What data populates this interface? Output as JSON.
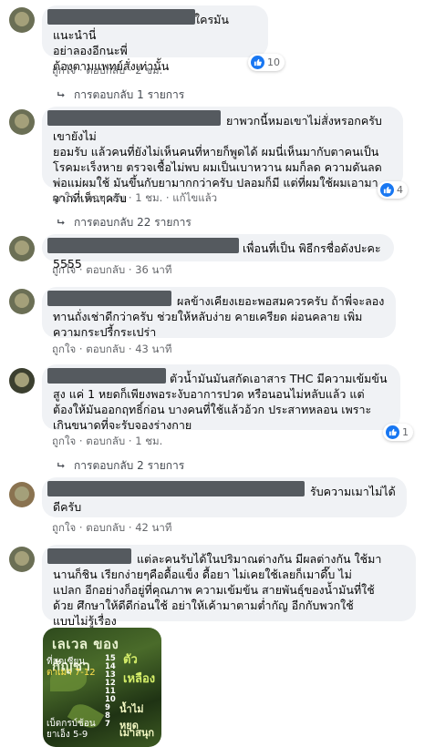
{
  "comments": [
    {
      "text": "ใครมันแนะนำนี่\nอย่าลองอีกนะพี่\nต้องตามแพทย์สั่งเท่านั้น",
      "like": "ถูกใจ",
      "reply": "ตอบกลับ",
      "time": "2 ชม.",
      "reaction_count": "10",
      "replies": "การตอบกลับ 1 รายการ"
    },
    {
      "text": "ยาพวกนี้หมอเขาไม่สั่งหรอกครับ เขายังไม่\nยอมรับ แล้วคนที่ยังไม่เห็นคนที่หายก็พูดได้ ผมนี่เห็นมากับตาคนเป็น\nโรคมะเร็งหาย ตรวจเชื้อไม่พบ ผมเป็นเบาหวาน ผมก็ลด ความดันลด\nพ่อแม่ผมใช้ มันขึ้นกับยามากกว่าครับ ปลอมก็มี แต่ที่ผมใช้ผมเอามา\nจากที่เห็นๆครับ",
      "like": "ถูกใจ",
      "reply": "ตอบกลับ",
      "time": "1 ชม.",
      "edited": "แก้ไขแล้ว",
      "reaction_count": "4",
      "replies": "การตอบกลับ 22 รายการ"
    },
    {
      "text": "เพื่อนที่เป็น พิธีกรชื่อดังปะคะ 5555",
      "like": "ถูกใจ",
      "reply": "ตอบกลับ",
      "time": "36 นาที"
    },
    {
      "text": "ผลข้างเคียงเยอะพอสมควรครับ ถ้าพี่จะลอง\nทานถั่งเช่าดีกว่าครับ ช่วยให้หลับง่าย คายเครียด ผ่อนคลาย เพิ่ม\nความกระปรี้กระเปร่า",
      "like": "ถูกใจ",
      "reply": "ตอบกลับ",
      "time": "43 นาที"
    },
    {
      "text": "ตัวน้ำมันมันสกัดเอาสาร THC มีความเข้มข้น\nสูง แค่ 1 หยดก็เพียงพอระงับอาการปวด หรือนอนไม่หลับแล้ว แต่\nต้องให้มันออกฤทธิ์ก่อน บางคนที่ใช้แล้วอ้วก ประสาทหลอน เพราะ\nเกินขนาดที่จะรับจองร่างกาย",
      "like": "ถูกใจ",
      "reply": "ตอบกลับ",
      "time": "1 ชม.",
      "reaction_count": "1",
      "replies": "การตอบกลับ 2 รายการ"
    },
    {
      "text": "รับความเมาไม่ได้\nดีครับ",
      "like": "ถูกใจ",
      "reply": "ตอบกลับ",
      "time": "42 นาที"
    },
    {
      "text": "แต่ละคนรับได้ในปริมาณต่างกัน มีผลต่างกัน ใช้มา\nนานก็ชิน เรียกง่ายๆคือดื้อแข็ง ดื้อยา ไม่เคยใช้เลยก็เมาดึ๊บ ไม่\nแปลก อีกอย่างก็อยู่ที่คุณภาพ ความเข้มข้น สายพันธุ์ของน้ำมันที่ใช้\nด้วย ศึกษาให้ดีดีก่อนใช้ อย่าให้เค้ามาตามต่ำกัญ อีกกับพวกใช้\nแบบไม่รู้เรื่อง"
    }
  ],
  "image": {
    "title": "เลเวล ของ กัญชา",
    "subtitle": "ตัวเหลือง",
    "numbers": "15\n14\n13\n12\n11\n10\n9\n8\n7",
    "label_mid": "น้ำไม่หยุด",
    "label_low": "เมาสนุก",
    "left_1": "ที่สุดเซียน",
    "left_2": "ตาเมา 7-12",
    "left_3": "เบ็ดกรบ์ช้อน",
    "left_4": "ยาเอ็ง 5-9"
  },
  "colors": {
    "bubble": "#f0f2f5",
    "meta": "#65676b",
    "like_blue": "#1877f2",
    "redaction": "#555a5f"
  }
}
